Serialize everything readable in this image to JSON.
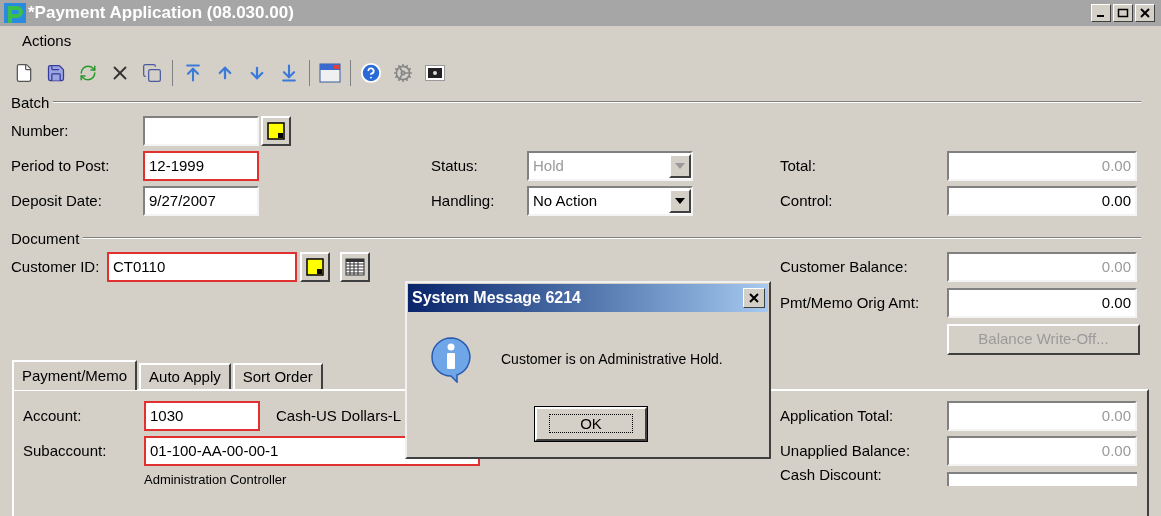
{
  "window": {
    "title": "*Payment Application (08.030.00)"
  },
  "menu": [
    {
      "label": "Actions"
    }
  ],
  "batch": {
    "title": "Batch",
    "left": [
      {
        "label": "Number:",
        "kind": "lookup",
        "required": false
      },
      {
        "label": "Period to Post:",
        "value": "12-1999",
        "kind": "text",
        "required": true
      },
      {
        "label": "Deposit Date:",
        "value": "9/27/2007",
        "kind": "text",
        "required": false
      }
    ],
    "middle": [
      {
        "label": "Status:",
        "value": "Hold",
        "disabled": true
      },
      {
        "label": "Handling:",
        "value": "No Action",
        "disabled": false
      }
    ],
    "right": [
      {
        "label": "Total:",
        "value": "0.00",
        "disabled": true
      },
      {
        "label": "Control:",
        "value": "0.00",
        "disabled": false
      }
    ]
  },
  "document": {
    "title": "Document",
    "customer": {
      "label": "Customer ID:",
      "value": "CT0110",
      "required": true
    },
    "right": [
      {
        "label": "Customer Balance:",
        "value": "0.00",
        "disabled": true
      },
      {
        "label": "Pmt/Memo Orig Amt:",
        "value": "0.00",
        "disabled": false
      }
    ],
    "write_off": {
      "label": "Balance Write-Off...",
      "disabled": true
    }
  },
  "tabs": [
    {
      "label": "Payment/Memo",
      "selected": true
    },
    {
      "label": "Auto Apply",
      "selected": false
    },
    {
      "label": "Sort Order",
      "selected": false
    }
  ],
  "payment": {
    "account": {
      "label": "Account:",
      "value": "1030",
      "required": true,
      "description": "Cash-US Dollars-L"
    },
    "subaccount": {
      "label": "Subaccount:",
      "value": "01-100-AA-00-00-1",
      "required": true,
      "description": "Administration Controller"
    },
    "right": [
      {
        "label": "Application Total:",
        "value": "0.00",
        "disabled": true
      },
      {
        "label": "Unapplied Balance:",
        "value": "0.00",
        "disabled": true
      },
      {
        "label": "Cash Discount:"
      }
    ]
  },
  "dialog": {
    "title": "System Message 6214",
    "message": "Customer is on Administrative Hold.",
    "buttons": [
      {
        "label": "OK",
        "focused": true
      }
    ]
  }
}
